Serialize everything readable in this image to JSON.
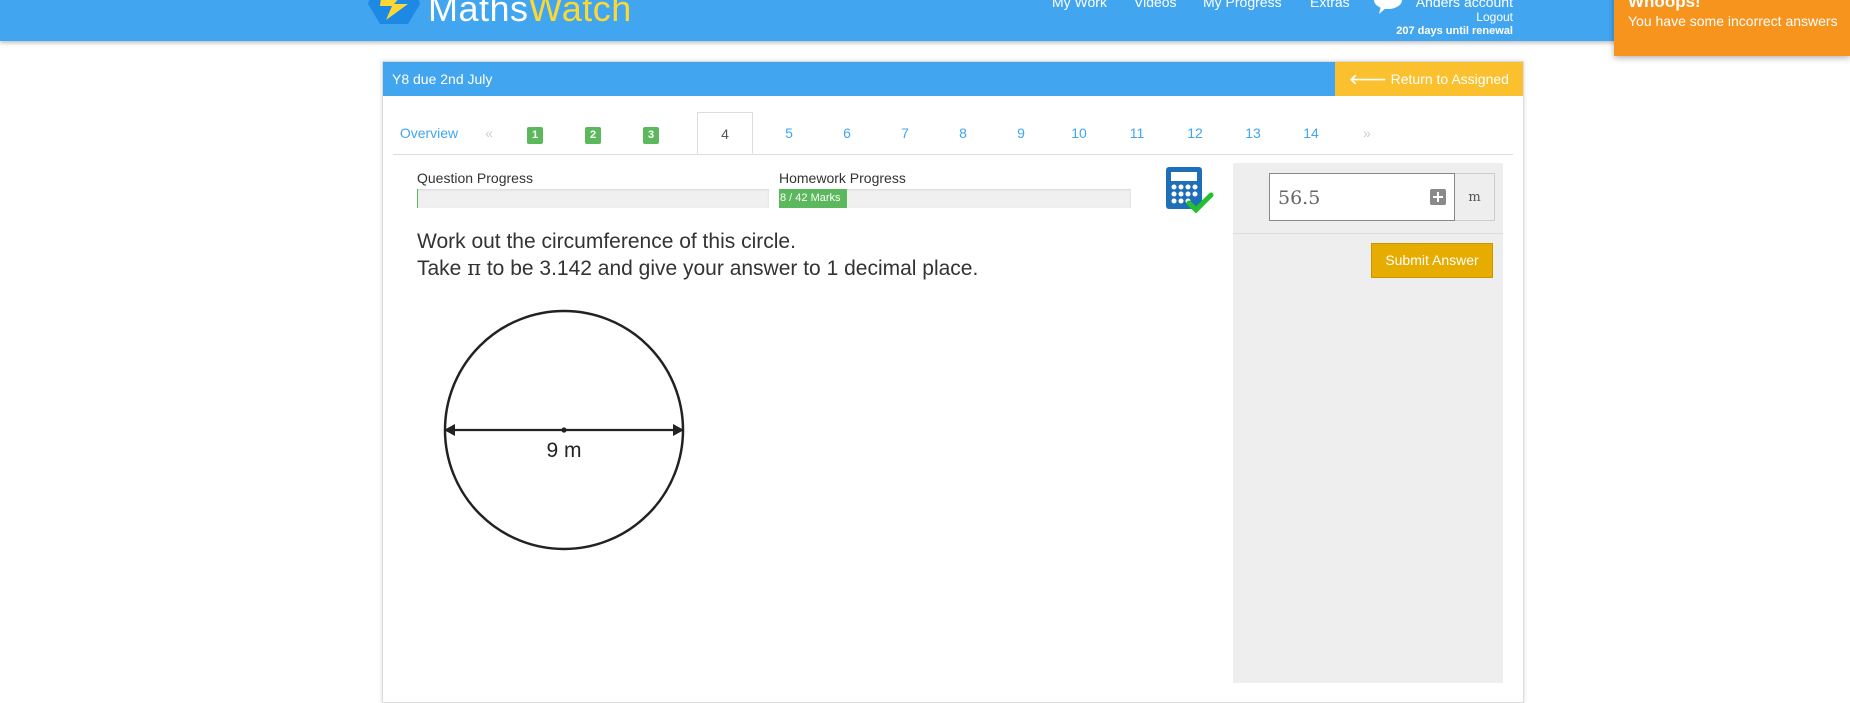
{
  "brand": {
    "name_part1": "Maths",
    "name_part2": "Watch"
  },
  "nav": {
    "links": [
      "My Work",
      "Videos",
      "My Progress",
      "Extras"
    ],
    "account_name": "Anders account",
    "logout": "Logout",
    "renewal": "207 days until renewal"
  },
  "toast": {
    "title": "Whoops!",
    "message": "You have some incorrect answers"
  },
  "header": {
    "title": "Y8 due 2nd July",
    "return_label": "Return to Assigned Work"
  },
  "tabs": {
    "overview": "Overview",
    "prev": "«",
    "next": "»",
    "completed": [
      "1",
      "2",
      "3"
    ],
    "active": "4",
    "rest": [
      "5",
      "6",
      "7",
      "8",
      "9",
      "10",
      "11",
      "12",
      "13",
      "14"
    ]
  },
  "progress": {
    "question_label": "Question Progress",
    "question_fraction": 0.0,
    "homework_label": "Homework Progress",
    "homework_text": "8 / 42 Marks",
    "homework_fraction": 0.19
  },
  "question": {
    "line1": "Work out the circumference of this circle.",
    "line2_before": "Take ",
    "pi_symbol": "π",
    "line2_after": " to be 3.142 and give your answer to 1 decimal place."
  },
  "diagram": {
    "diameter_label": "9 m"
  },
  "answer": {
    "value": "56.5",
    "unit": "m",
    "submit_label": "Submit Answer"
  },
  "colors": {
    "primary": "#42a5f0",
    "accent": "#fbc02d",
    "success": "#5cb85c",
    "toast": "#f7941d",
    "submit": "#e6ac00"
  },
  "icons": [
    "logo-icon",
    "chat-icon",
    "calculator-icon",
    "checkmark-icon",
    "arrow-left-icon",
    "plus-icon"
  ]
}
